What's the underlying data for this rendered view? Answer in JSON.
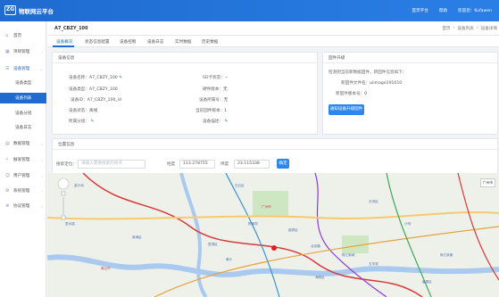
{
  "app": {
    "title": "物联网云平台",
    "logo_text": "ZG"
  },
  "topbar": {
    "home": "首页平台",
    "help": "帮助",
    "welcome": "欢迎您：Kufawen"
  },
  "sidebar": {
    "items": [
      {
        "label": "首页",
        "icon": "home-icon"
      },
      {
        "label": "项目管理",
        "icon": "project-icon"
      },
      {
        "label": "设备管理",
        "icon": "device-icon"
      },
      {
        "label": "数据管理",
        "icon": "data-icon"
      },
      {
        "label": "触发管理",
        "icon": "trigger-icon"
      },
      {
        "label": "用户管理",
        "icon": "user-icon"
      },
      {
        "label": "系统管理",
        "icon": "system-icon"
      },
      {
        "label": "协议管理",
        "icon": "protocol-icon"
      }
    ],
    "sub_items": [
      {
        "label": "设备类型"
      },
      {
        "label": "设备列表"
      },
      {
        "label": "设备分组"
      },
      {
        "label": "设备日志"
      }
    ]
  },
  "page": {
    "title": "A7_CBZY_100",
    "crumbs": [
      "首页",
      "设备列表",
      "设备详情"
    ]
  },
  "tabs": [
    "设备概况",
    "状态信息配置",
    "设备控制",
    "设备日志",
    "实时数据",
    "历史数据"
  ],
  "device_info": {
    "title": "设备信息",
    "rows": [
      {
        "label": "设备名称：",
        "value": "A7_CBZY_100"
      },
      {
        "label": "设备类型：",
        "value": "A7_CBZY_100"
      },
      {
        "label": "设备ID：",
        "value": "A7_CBZY_100_id"
      },
      {
        "label": "设备状态：",
        "value": "离线"
      },
      {
        "label": "所属分组：",
        "value": ""
      }
    ],
    "right_rows": [
      {
        "label": "SD卡状态：",
        "value": "--"
      },
      {
        "label": "硬件版本：",
        "value": "无"
      },
      {
        "label": "设备所属号：",
        "value": "无"
      },
      {
        "label": "当前固件版本：",
        "value": "1"
      },
      {
        "label": "设备描述：",
        "value": ""
      }
    ]
  },
  "firmware": {
    "title": "固件升级",
    "desc": "检测到当前新数据固件，新固件信息如下：",
    "file_label": "新固件文件名：",
    "file_value": "ulimage191010",
    "version_label": "新固件版本号：",
    "version_value": "0",
    "upgrade_button": "通知设备升级固件"
  },
  "location": {
    "title": "位置信息",
    "search_label": "搜索定位：",
    "search_placeholder": "请输入需要搜索的地点",
    "lng_label": "经度",
    "lng_value": "113.278755",
    "lat_label": "纬度",
    "lat_value": "23.115338",
    "locate_button": "确定"
  },
  "map": {
    "city_tag": "广州市",
    "labels": [
      "金沙洲",
      "里水镇",
      "佛山市",
      "广州市",
      "天河区",
      "海珠区",
      "越秀区",
      "荔湾区",
      "白云区",
      "珠江新城",
      "番禺区",
      "南海区",
      "黄沙",
      "陈家祠",
      "北京路",
      "沙河",
      "五羊邨",
      "珠江帝景"
    ]
  }
}
